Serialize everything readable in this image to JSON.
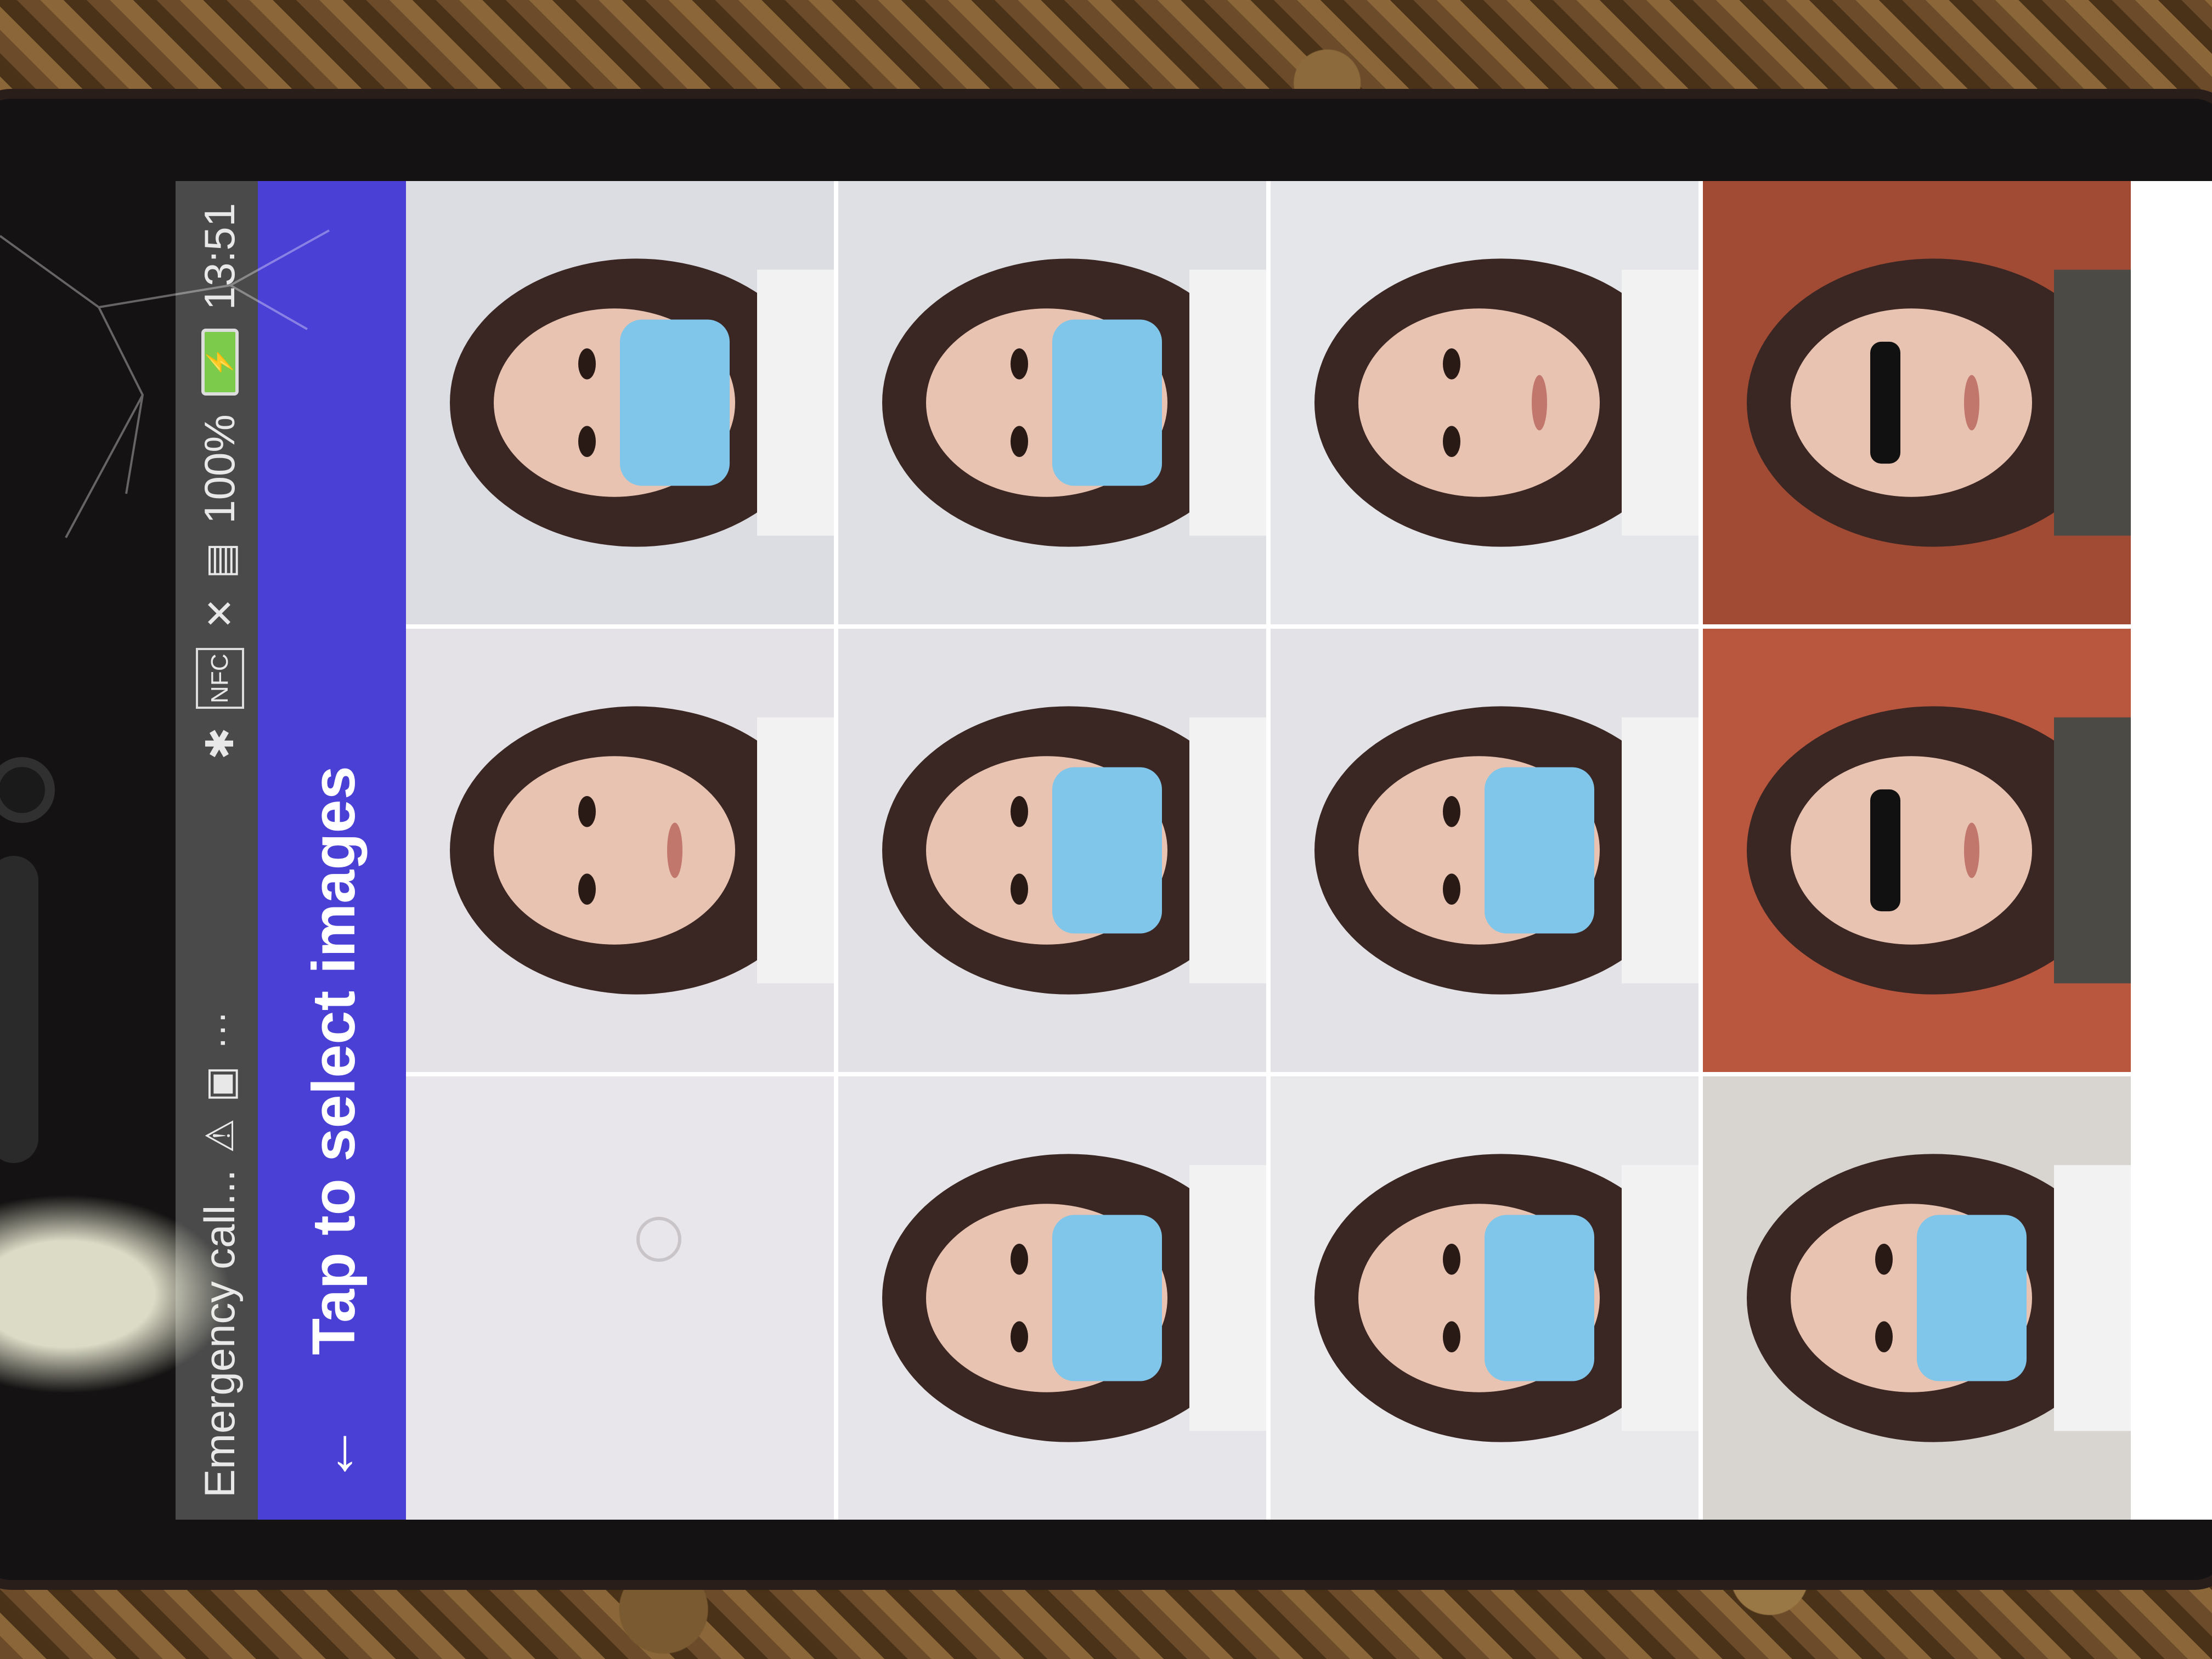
{
  "status_bar": {
    "left_text": "Emergency call...",
    "battery_percent": "100%",
    "time": "13:51",
    "icons": [
      "sim-alert-icon",
      "screenshot-icon",
      "more-dots-icon",
      "bluetooth-icon",
      "nfc-icon",
      "mute-icon",
      "sim-icon",
      "battery-icon"
    ],
    "nfc_label": "NFC",
    "more_dots": "···"
  },
  "app_bar": {
    "back_icon": "←",
    "title": "Tap to select images",
    "color": "#4a40d6"
  },
  "gallery": {
    "images": [
      {
        "subject": "white wall",
        "mask": false
      },
      {
        "subject": "woman portrait",
        "mask": false
      },
      {
        "subject": "woman with surgical mask",
        "mask": true
      },
      {
        "subject": "woman with surgical mask",
        "mask": true
      },
      {
        "subject": "woman with surgical mask",
        "mask": true
      },
      {
        "subject": "woman with surgical mask",
        "mask": true
      },
      {
        "subject": "woman with surgical mask",
        "mask": true
      },
      {
        "subject": "woman with surgical mask",
        "mask": true
      },
      {
        "subject": "woman portrait",
        "mask": false
      },
      {
        "subject": "woman with surgical mask",
        "mask": true
      },
      {
        "subject": "woman with sunglasses by brick wall",
        "mask": false
      },
      {
        "subject": "woman with sunglasses by door",
        "mask": false
      }
    ]
  }
}
